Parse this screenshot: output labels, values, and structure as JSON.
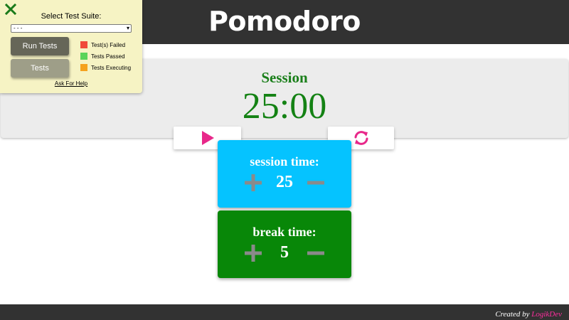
{
  "header": {
    "title": "Pomodoro"
  },
  "timer": {
    "label": "Session",
    "time": "25:00"
  },
  "controls": {
    "play_icon": "play-icon",
    "reset_icon": "refresh-icon",
    "accent": "#e8288a"
  },
  "session_setting": {
    "title": "session time:",
    "value": "25",
    "color": "#05c3ff"
  },
  "break_setting": {
    "title": "break time:",
    "value": "5",
    "color": "#088708"
  },
  "footer": {
    "prefix": "Created by",
    "author": "LogikDev"
  },
  "test_panel": {
    "heading": "Select Test Suite:",
    "select_value": "- - -",
    "run_label": "Run Tests",
    "tests_label": "Tests",
    "legend": [
      {
        "label": "Test(s) Failed",
        "color": "#f04a3a"
      },
      {
        "label": "Tests Passed",
        "color": "#5ad45a"
      },
      {
        "label": "Tests Executing",
        "color": "#f5a21e"
      }
    ],
    "help_link": "Ask For Help"
  }
}
